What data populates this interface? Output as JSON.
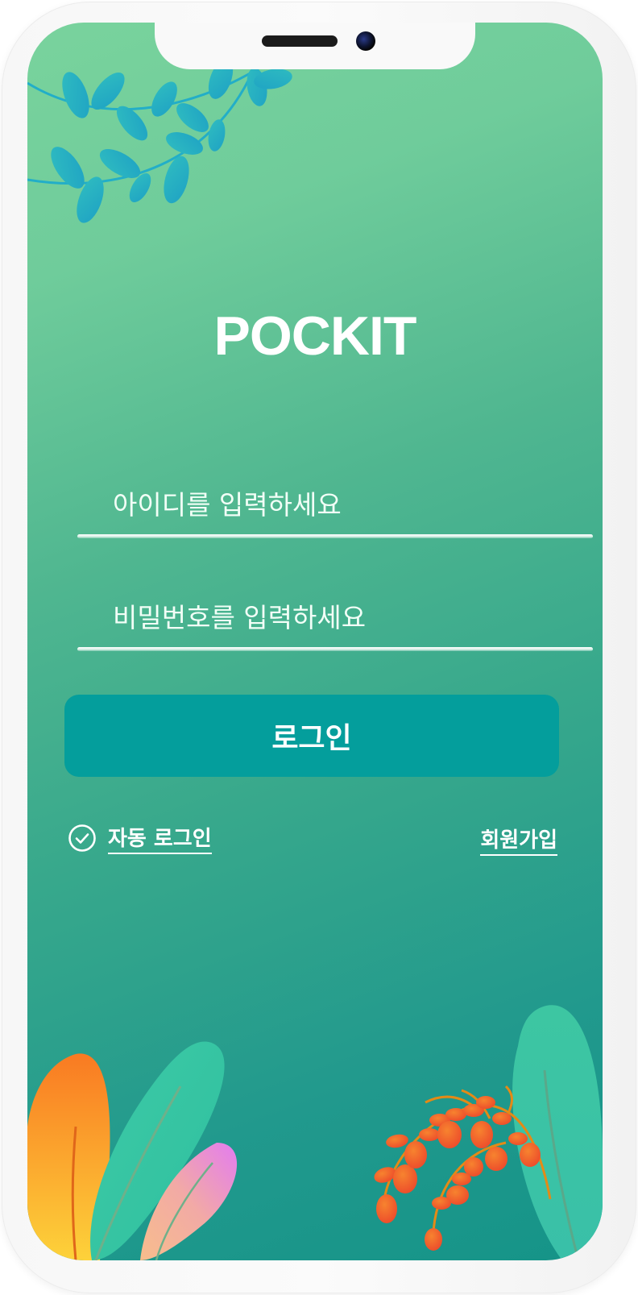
{
  "app": {
    "title": "POCKIT"
  },
  "login_form": {
    "id_placeholder": "아이디를 입력하세요",
    "password_placeholder": "비밀번호를 입력하세요",
    "login_button_label": "로그인"
  },
  "options": {
    "auto_login_label": "자동 로그인",
    "signup_label": "회원가입",
    "auto_login_checked": true
  },
  "colors": {
    "background_top": "#79d39d",
    "background_bottom": "#159488",
    "button": "#049e9c",
    "text": "#ffffff"
  },
  "icons": {
    "auto_login_check": "check-circle-icon"
  }
}
